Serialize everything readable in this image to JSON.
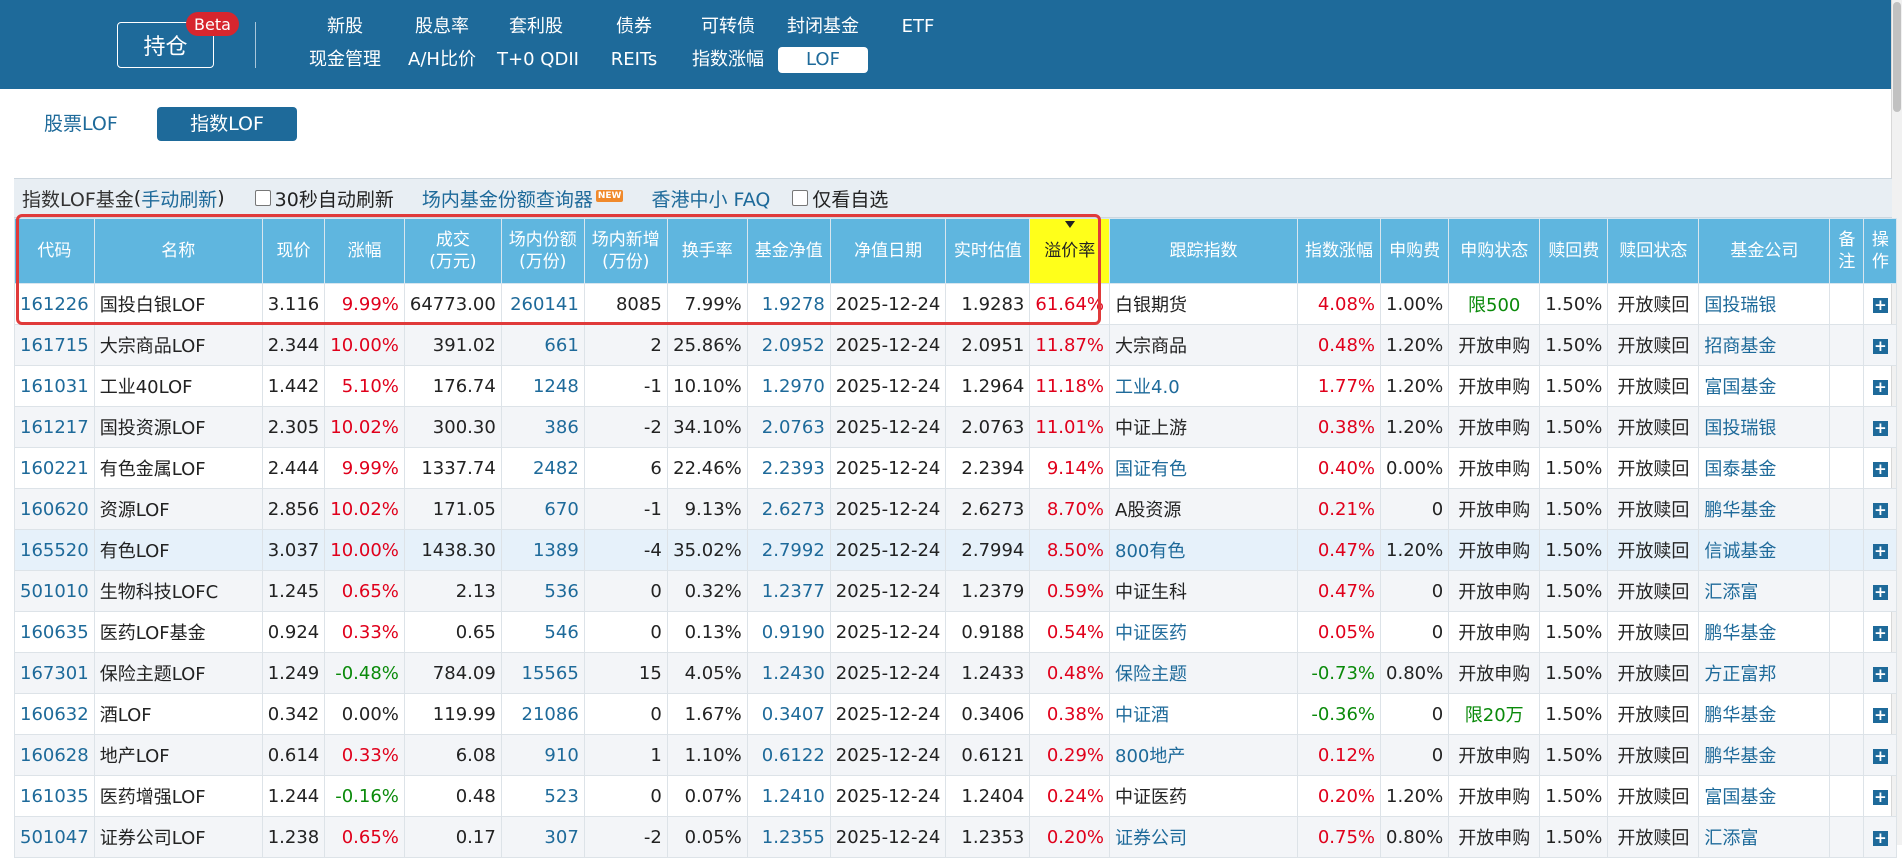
{
  "header": {
    "holding_label": "持仓",
    "beta_label": "Beta",
    "nav_row1": [
      "新股",
      "股息率",
      "套利股",
      "债券",
      "可转债",
      "封闭基金",
      "ETF"
    ],
    "nav_row2": [
      "现金管理",
      "A/H比价",
      "T+0 QDII",
      "REITs",
      "指数涨幅",
      "LOF"
    ],
    "active_nav": "LOF"
  },
  "tabs": [
    "股票LOF",
    "指数LOF"
  ],
  "active_tab": "指数LOF",
  "toolbar": {
    "title": "指数LOF基金",
    "refresh_link": "手动刷新",
    "auto_refresh": "30秒自动刷新",
    "query_link": "场内基金份额查询器",
    "new_badge": "NEW",
    "faq_link": "香港中小 FAQ",
    "watch_only": "仅看自选"
  },
  "columns": [
    "代码",
    "名称",
    "现价",
    "涨幅",
    "成交\n(万元)",
    "场内份额\n(万份)",
    "场内新增\n(万份)",
    "换手率",
    "基金净值",
    "净值日期",
    "实时估值",
    "溢价率",
    "跟踪指数",
    "指数涨幅",
    "申购费",
    "申购状态",
    "赎回费",
    "赎回状态",
    "基金公司",
    "备\n注",
    "操\n作"
  ],
  "sorted_column": "溢价率",
  "colors": {
    "header_bar": "#1e6a9a",
    "table_header": "#5fb6df",
    "sorted_header": "#ffff1a",
    "up": "#e0001b",
    "down": "#0a8a0a",
    "link": "#1e6a9a",
    "highlight_box": "#e03a3a"
  },
  "rows": [
    {
      "code": "161226",
      "name": "国投白银LOF",
      "price": "3.116",
      "change": "9.99%",
      "volume": "64773.00",
      "shares": "260141",
      "new_shares": "8085",
      "turnover": "7.99%",
      "nav": "1.9278",
      "nav_date": "2025-12-24",
      "estimate": "1.9283",
      "premium": "61.64%",
      "index": "白银期货",
      "index_link": false,
      "index_change": "4.08%",
      "sub_fee": "1.00%",
      "sub_status": "限500",
      "sub_limited": true,
      "red_fee": "1.50%",
      "red_status": "开放赎回",
      "company": "国投瑞银"
    },
    {
      "code": "161715",
      "name": "大宗商品LOF",
      "price": "2.344",
      "change": "10.00%",
      "volume": "391.02",
      "shares": "661",
      "new_shares": "2",
      "turnover": "25.86%",
      "nav": "2.0952",
      "nav_date": "2025-12-24",
      "estimate": "2.0951",
      "premium": "11.87%",
      "index": "大宗商品",
      "index_link": false,
      "index_change": "0.48%",
      "sub_fee": "1.20%",
      "sub_status": "开放申购",
      "sub_limited": false,
      "red_fee": "1.50%",
      "red_status": "开放赎回",
      "company": "招商基金"
    },
    {
      "code": "161031",
      "name": "工业40LOF",
      "price": "1.442",
      "change": "5.10%",
      "volume": "176.74",
      "shares": "1248",
      "new_shares": "-1",
      "turnover": "10.10%",
      "nav": "1.2970",
      "nav_date": "2025-12-24",
      "estimate": "1.2964",
      "premium": "11.18%",
      "index": "工业4.0",
      "index_link": true,
      "index_change": "1.77%",
      "sub_fee": "1.20%",
      "sub_status": "开放申购",
      "sub_limited": false,
      "red_fee": "1.50%",
      "red_status": "开放赎回",
      "company": "富国基金"
    },
    {
      "code": "161217",
      "name": "国投资源LOF",
      "price": "2.305",
      "change": "10.02%",
      "volume": "300.30",
      "shares": "386",
      "new_shares": "-2",
      "turnover": "34.10%",
      "nav": "2.0763",
      "nav_date": "2025-12-24",
      "estimate": "2.0763",
      "premium": "11.01%",
      "index": "中证上游",
      "index_link": false,
      "index_change": "0.38%",
      "sub_fee": "1.20%",
      "sub_status": "开放申购",
      "sub_limited": false,
      "red_fee": "1.50%",
      "red_status": "开放赎回",
      "company": "国投瑞银"
    },
    {
      "code": "160221",
      "name": "有色金属LOF",
      "price": "2.444",
      "change": "9.99%",
      "volume": "1337.74",
      "shares": "2482",
      "new_shares": "6",
      "turnover": "22.46%",
      "nav": "2.2393",
      "nav_date": "2025-12-24",
      "estimate": "2.2394",
      "premium": "9.14%",
      "index": "国证有色",
      "index_link": true,
      "index_change": "0.40%",
      "sub_fee": "0.00%",
      "sub_status": "开放申购",
      "sub_limited": false,
      "red_fee": "1.50%",
      "red_status": "开放赎回",
      "company": "国泰基金"
    },
    {
      "code": "160620",
      "name": "资源LOF",
      "price": "2.856",
      "change": "10.02%",
      "volume": "171.05",
      "shares": "670",
      "new_shares": "-1",
      "turnover": "9.13%",
      "nav": "2.6273",
      "nav_date": "2025-12-24",
      "estimate": "2.6273",
      "premium": "8.70%",
      "index": "A股资源",
      "index_link": false,
      "index_change": "0.21%",
      "sub_fee": "0",
      "sub_status": "开放申购",
      "sub_limited": false,
      "red_fee": "1.50%",
      "red_status": "开放赎回",
      "company": "鹏华基金"
    },
    {
      "code": "165520",
      "name": "有色LOF",
      "price": "3.037",
      "change": "10.00%",
      "volume": "1438.30",
      "shares": "1389",
      "new_shares": "-4",
      "turnover": "35.02%",
      "nav": "2.7992",
      "nav_date": "2025-12-24",
      "estimate": "2.7994",
      "premium": "8.50%",
      "index": "800有色",
      "index_link": true,
      "index_change": "0.47%",
      "sub_fee": "1.20%",
      "sub_status": "开放申购",
      "sub_limited": false,
      "red_fee": "1.50%",
      "red_status": "开放赎回",
      "company": "信诚基金"
    },
    {
      "code": "501010",
      "name": "生物科技LOFC",
      "price": "1.245",
      "change": "0.65%",
      "volume": "2.13",
      "shares": "536",
      "new_shares": "0",
      "turnover": "0.32%",
      "nav": "1.2377",
      "nav_date": "2025-12-24",
      "estimate": "1.2379",
      "premium": "0.59%",
      "index": "中证生科",
      "index_link": false,
      "index_change": "0.47%",
      "sub_fee": "0",
      "sub_status": "开放申购",
      "sub_limited": false,
      "red_fee": "1.50%",
      "red_status": "开放赎回",
      "company": "汇添富"
    },
    {
      "code": "160635",
      "name": "医药LOF基金",
      "price": "0.924",
      "change": "0.33%",
      "volume": "0.65",
      "shares": "546",
      "new_shares": "0",
      "turnover": "0.13%",
      "nav": "0.9190",
      "nav_date": "2025-12-24",
      "estimate": "0.9188",
      "premium": "0.54%",
      "index": "中证医药",
      "index_link": true,
      "index_change": "0.05%",
      "sub_fee": "0",
      "sub_status": "开放申购",
      "sub_limited": false,
      "red_fee": "1.50%",
      "red_status": "开放赎回",
      "company": "鹏华基金"
    },
    {
      "code": "167301",
      "name": "保险主题LOF",
      "price": "1.249",
      "change": "-0.48%",
      "volume": "784.09",
      "shares": "15565",
      "new_shares": "15",
      "turnover": "4.05%",
      "nav": "1.2430",
      "nav_date": "2025-12-24",
      "estimate": "1.2433",
      "premium": "0.48%",
      "index": "保险主题",
      "index_link": true,
      "index_change": "-0.73%",
      "sub_fee": "0.80%",
      "sub_status": "开放申购",
      "sub_limited": false,
      "red_fee": "1.50%",
      "red_status": "开放赎回",
      "company": "方正富邦"
    },
    {
      "code": "160632",
      "name": "酒LOF",
      "price": "0.342",
      "change": "0.00%",
      "volume": "119.99",
      "shares": "21086",
      "new_shares": "0",
      "turnover": "1.67%",
      "nav": "0.3407",
      "nav_date": "2025-12-24",
      "estimate": "0.3406",
      "premium": "0.38%",
      "index": "中证酒",
      "index_link": true,
      "index_change": "-0.36%",
      "sub_fee": "0",
      "sub_status": "限20万",
      "sub_limited": true,
      "red_fee": "1.50%",
      "red_status": "开放赎回",
      "company": "鹏华基金"
    },
    {
      "code": "160628",
      "name": "地产LOF",
      "price": "0.614",
      "change": "0.33%",
      "volume": "6.08",
      "shares": "910",
      "new_shares": "1",
      "turnover": "1.10%",
      "nav": "0.6122",
      "nav_date": "2025-12-24",
      "estimate": "0.6121",
      "premium": "0.29%",
      "index": "800地产",
      "index_link": true,
      "index_change": "0.12%",
      "sub_fee": "0",
      "sub_status": "开放申购",
      "sub_limited": false,
      "red_fee": "1.50%",
      "red_status": "开放赎回",
      "company": "鹏华基金"
    },
    {
      "code": "161035",
      "name": "医药增强LOF",
      "price": "1.244",
      "change": "-0.16%",
      "volume": "0.48",
      "shares": "523",
      "new_shares": "0",
      "turnover": "0.07%",
      "nav": "1.2410",
      "nav_date": "2025-12-24",
      "estimate": "1.2404",
      "premium": "0.24%",
      "index": "中证医药",
      "index_link": false,
      "index_change": "0.20%",
      "sub_fee": "1.20%",
      "sub_status": "开放申购",
      "sub_limited": false,
      "red_fee": "1.50%",
      "red_status": "开放赎回",
      "company": "富国基金"
    },
    {
      "code": "501047",
      "name": "证券公司LOF",
      "price": "1.238",
      "change": "0.65%",
      "volume": "0.17",
      "shares": "307",
      "new_shares": "-2",
      "turnover": "0.05%",
      "nav": "1.2355",
      "nav_date": "2025-12-24",
      "estimate": "1.2353",
      "premium": "0.20%",
      "index": "证券公司",
      "index_link": true,
      "index_change": "0.75%",
      "sub_fee": "0.80%",
      "sub_status": "开放申购",
      "sub_limited": false,
      "red_fee": "1.50%",
      "red_status": "开放赎回",
      "company": "汇添富"
    }
  ]
}
